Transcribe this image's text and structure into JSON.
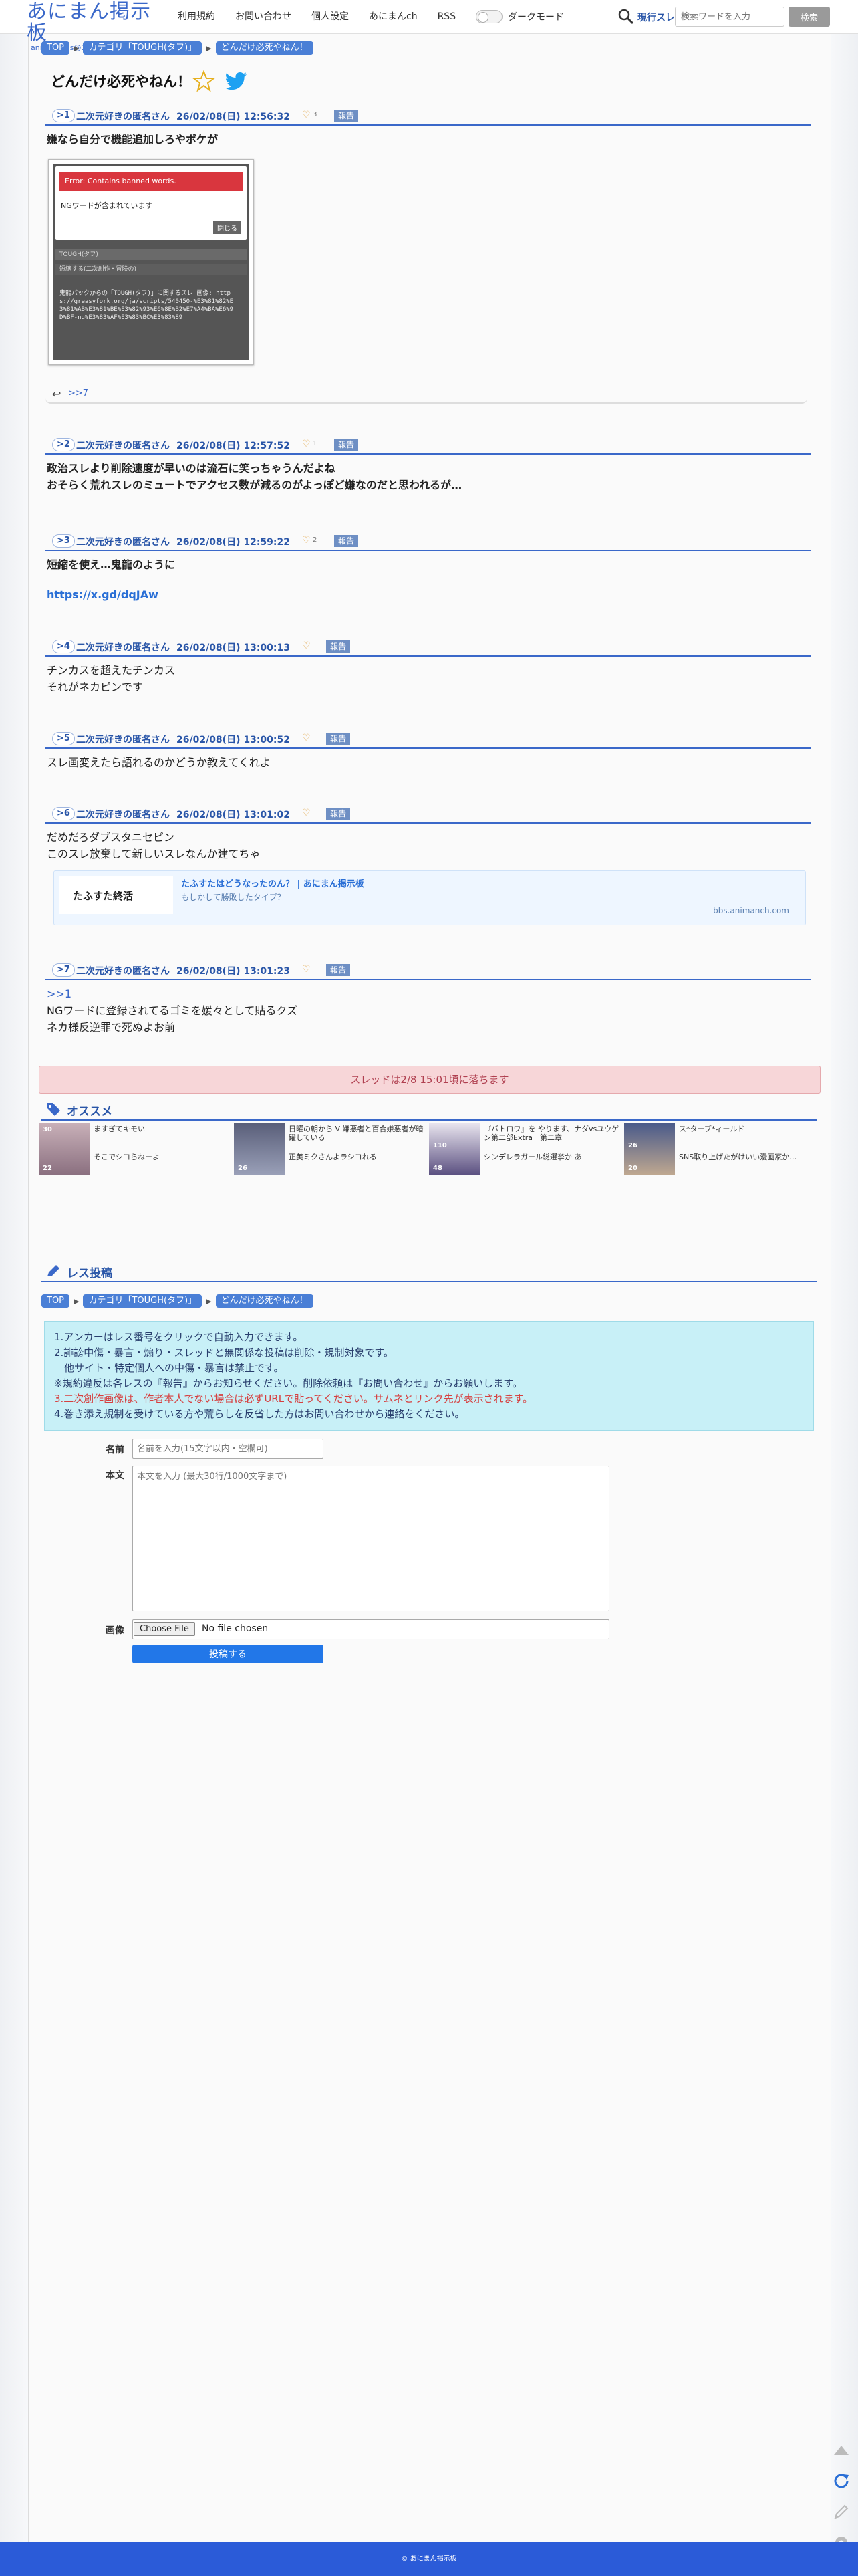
{
  "header": {
    "logo_main": "あにまん掲示板",
    "logo_sub": "animan bbs@二次元オリジー",
    "nav": [
      "利用規約",
      "お問い合わせ",
      "個人設定",
      "あにまんch",
      "RSS"
    ],
    "dark_mode_label": "ダークモード",
    "search_scope": "現行スレ",
    "search_placeholder": "検索ワードを入力",
    "search_button": "検索"
  },
  "breadcrumb": [
    "TOP",
    "カテゴリ「TOUGH(タフ)」",
    "どんだけ必死やねん！"
  ],
  "thread_title": "どんだけ必死やねん！",
  "posts": [
    {
      "num": ">1",
      "name": "二次元好きの匿名さん",
      "date": "26/02/08(日) 12:56:32",
      "likes": "3",
      "report": "報告",
      "lines": [
        "嫌なら自分で機能追加しろやボケが"
      ],
      "reply_anchor": ">>7"
    },
    {
      "num": ">2",
      "name": "二次元好きの匿名さん",
      "date": "26/02/08(日) 12:57:52",
      "likes": "1",
      "report": "報告",
      "lines": [
        "政治スレより削除速度が早いのは流石に笑っちゃうんだよね",
        "おそらく荒れスレのミュートでアクセス数が減るのがよっぽど嫌なのだと思われるが…"
      ]
    },
    {
      "num": ">3",
      "name": "二次元好きの匿名さん",
      "date": "26/02/08(日) 12:59:22",
      "likes": "2",
      "report": "報告",
      "lines": [
        "短縮を使え…鬼龍のように"
      ],
      "link": "https://x.gd/dqJAw"
    },
    {
      "num": ">4",
      "name": "二次元好きの匿名さん",
      "date": "26/02/08(日) 13:00:13",
      "likes": "",
      "report": "報告",
      "lines": [
        "チンカスを超えたチンカス",
        "それがネカピンです"
      ]
    },
    {
      "num": ">5",
      "name": "二次元好きの匿名さん",
      "date": "26/02/08(日) 13:00:52",
      "likes": "",
      "report": "報告",
      "lines": [
        "スレ画変えたら語れるのかどうか教えてくれよ"
      ]
    },
    {
      "num": ">6",
      "name": "二次元好きの匿名さん",
      "date": "26/02/08(日) 13:01:02",
      "likes": "",
      "report": "報告",
      "lines": [
        "だめだろダブスタニセピン",
        "このスレ放棄して新しいスレなんか建てちゃ"
      ]
    },
    {
      "num": ">7",
      "name": "二次元好きの匿名さん",
      "date": "26/02/08(日) 13:01:23",
      "likes": "",
      "report": "報告",
      "anchor": ">>1",
      "lines": [
        "NGワードに登録されてるゴミを媛々として貼るクズ",
        "ネカ様反逆罪で死ぬよお前"
      ]
    }
  ],
  "screenshot": {
    "error": "Error: Contains banned words.",
    "message": "NGワードが含まれています",
    "close": "閉じる",
    "field1": "TOUGH(タフ)",
    "field2": "短縮する(二次創作・冒険の)",
    "text": "鬼龍バックからの「TOUGH(タフ)」に関するスレ 画像: https://greasyfork.org/ja/scripts/540450-%E3%81%82%E3%81%AB%E3%81%BE%E3%82%93%E6%8E%B2%E7%A4%BA%E6%9D%BF-ng%E3%83%AF%E3%83%BC%E3%83%89"
  },
  "link_card": {
    "title": "たふすたはどうなったのん？ | あにまん掲示板",
    "desc": "もしかして勝敗したタイプ？",
    "domain": "bbs.animanch.com",
    "image_text": "たふすた終活"
  },
  "fallen_notice": "スレッドは2/8 15:01頃に落ちます",
  "recommend": {
    "title": "オススメ",
    "items": [
      {
        "count": "30",
        "title": "ますぎてキモい"
      },
      {
        "count": "22",
        "title": "そこでシコらねーよ"
      },
      {
        "count": "",
        "title": "日曜の朝から V 嫌悪者と百合嫌悪者が暗躍している"
      },
      {
        "count": "26",
        "title": "正美ミクさんよラシコれる"
      },
      {
        "count": "110",
        "title": "『バトロワ』を やります、ナダvsユウゲン第二部Extra　第二章"
      },
      {
        "count": "48",
        "title": "シンデレラガール総選挙か あ"
      },
      {
        "count": "26",
        "title": "ス*ターブ*ィールド"
      },
      {
        "count": "20",
        "title": "SNS取り上げたがけいい漫画家か…"
      }
    ]
  },
  "form": {
    "title": "レス投稿",
    "notice": [
      "1.アンカーはレス番号をクリックで自動入力できます。",
      "2.誹謗中傷・暴言・煽り・スレッドと無関係な投稿は削除・規制対象です。",
      "　他サイト・特定個人への中傷・暴言は禁止です。",
      "※規約違反は各レスの『報告』からお知らせください。削除依頼は『お問い合わせ』からお願いします。",
      "3.二次創作画像は、作者本人でない場合は必ずURLで貼ってください。サムネとリンク先が表示されます。",
      "4.巻き添え規制を受けている方や荒らしを反省した方はお問い合わせから連絡をください。"
    ],
    "name_label": "名前",
    "name_placeholder": "名前を入力(15文字以内・空欄可)",
    "body_label": "本文",
    "body_placeholder": "本文を入力 (最大30行/1000文字まで)",
    "image_label": "画像",
    "file_button": "Choose File",
    "file_none": "No file chosen",
    "submit": "投稿する"
  },
  "footer": "© あにまん掲示板",
  "colors": {
    "accent": "#3a68c9",
    "footer": "#2b5bd8",
    "fallen_bg": "#f7d6d8",
    "notice_bg": "#c8f0f7"
  }
}
